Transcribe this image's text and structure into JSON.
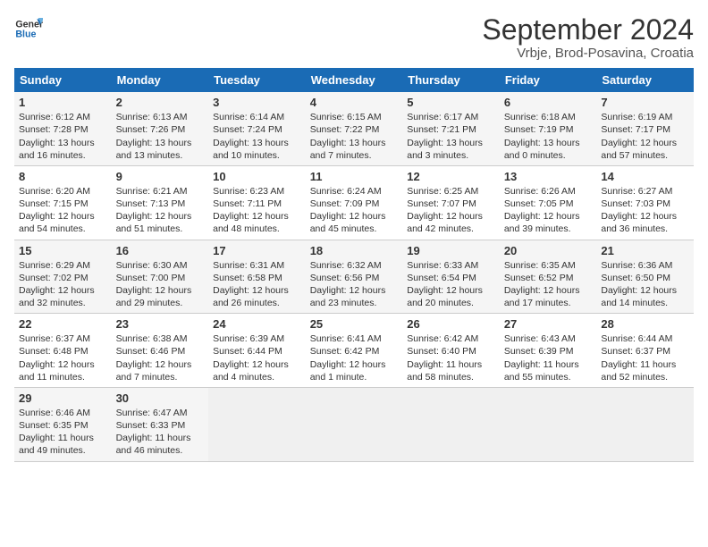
{
  "logo": {
    "text_general": "General",
    "text_blue": "Blue"
  },
  "title": "September 2024",
  "subtitle": "Vrbje, Brod-Posavina, Croatia",
  "headers": [
    "Sunday",
    "Monday",
    "Tuesday",
    "Wednesday",
    "Thursday",
    "Friday",
    "Saturday"
  ],
  "weeks": [
    [
      {
        "day": "1",
        "sunrise": "Sunrise: 6:12 AM",
        "sunset": "Sunset: 7:28 PM",
        "daylight": "Daylight: 13 hours and 16 minutes."
      },
      {
        "day": "2",
        "sunrise": "Sunrise: 6:13 AM",
        "sunset": "Sunset: 7:26 PM",
        "daylight": "Daylight: 13 hours and 13 minutes."
      },
      {
        "day": "3",
        "sunrise": "Sunrise: 6:14 AM",
        "sunset": "Sunset: 7:24 PM",
        "daylight": "Daylight: 13 hours and 10 minutes."
      },
      {
        "day": "4",
        "sunrise": "Sunrise: 6:15 AM",
        "sunset": "Sunset: 7:22 PM",
        "daylight": "Daylight: 13 hours and 7 minutes."
      },
      {
        "day": "5",
        "sunrise": "Sunrise: 6:17 AM",
        "sunset": "Sunset: 7:21 PM",
        "daylight": "Daylight: 13 hours and 3 minutes."
      },
      {
        "day": "6",
        "sunrise": "Sunrise: 6:18 AM",
        "sunset": "Sunset: 7:19 PM",
        "daylight": "Daylight: 13 hours and 0 minutes."
      },
      {
        "day": "7",
        "sunrise": "Sunrise: 6:19 AM",
        "sunset": "Sunset: 7:17 PM",
        "daylight": "Daylight: 12 hours and 57 minutes."
      }
    ],
    [
      {
        "day": "8",
        "sunrise": "Sunrise: 6:20 AM",
        "sunset": "Sunset: 7:15 PM",
        "daylight": "Daylight: 12 hours and 54 minutes."
      },
      {
        "day": "9",
        "sunrise": "Sunrise: 6:21 AM",
        "sunset": "Sunset: 7:13 PM",
        "daylight": "Daylight: 12 hours and 51 minutes."
      },
      {
        "day": "10",
        "sunrise": "Sunrise: 6:23 AM",
        "sunset": "Sunset: 7:11 PM",
        "daylight": "Daylight: 12 hours and 48 minutes."
      },
      {
        "day": "11",
        "sunrise": "Sunrise: 6:24 AM",
        "sunset": "Sunset: 7:09 PM",
        "daylight": "Daylight: 12 hours and 45 minutes."
      },
      {
        "day": "12",
        "sunrise": "Sunrise: 6:25 AM",
        "sunset": "Sunset: 7:07 PM",
        "daylight": "Daylight: 12 hours and 42 minutes."
      },
      {
        "day": "13",
        "sunrise": "Sunrise: 6:26 AM",
        "sunset": "Sunset: 7:05 PM",
        "daylight": "Daylight: 12 hours and 39 minutes."
      },
      {
        "day": "14",
        "sunrise": "Sunrise: 6:27 AM",
        "sunset": "Sunset: 7:03 PM",
        "daylight": "Daylight: 12 hours and 36 minutes."
      }
    ],
    [
      {
        "day": "15",
        "sunrise": "Sunrise: 6:29 AM",
        "sunset": "Sunset: 7:02 PM",
        "daylight": "Daylight: 12 hours and 32 minutes."
      },
      {
        "day": "16",
        "sunrise": "Sunrise: 6:30 AM",
        "sunset": "Sunset: 7:00 PM",
        "daylight": "Daylight: 12 hours and 29 minutes."
      },
      {
        "day": "17",
        "sunrise": "Sunrise: 6:31 AM",
        "sunset": "Sunset: 6:58 PM",
        "daylight": "Daylight: 12 hours and 26 minutes."
      },
      {
        "day": "18",
        "sunrise": "Sunrise: 6:32 AM",
        "sunset": "Sunset: 6:56 PM",
        "daylight": "Daylight: 12 hours and 23 minutes."
      },
      {
        "day": "19",
        "sunrise": "Sunrise: 6:33 AM",
        "sunset": "Sunset: 6:54 PM",
        "daylight": "Daylight: 12 hours and 20 minutes."
      },
      {
        "day": "20",
        "sunrise": "Sunrise: 6:35 AM",
        "sunset": "Sunset: 6:52 PM",
        "daylight": "Daylight: 12 hours and 17 minutes."
      },
      {
        "day": "21",
        "sunrise": "Sunrise: 6:36 AM",
        "sunset": "Sunset: 6:50 PM",
        "daylight": "Daylight: 12 hours and 14 minutes."
      }
    ],
    [
      {
        "day": "22",
        "sunrise": "Sunrise: 6:37 AM",
        "sunset": "Sunset: 6:48 PM",
        "daylight": "Daylight: 12 hours and 11 minutes."
      },
      {
        "day": "23",
        "sunrise": "Sunrise: 6:38 AM",
        "sunset": "Sunset: 6:46 PM",
        "daylight": "Daylight: 12 hours and 7 minutes."
      },
      {
        "day": "24",
        "sunrise": "Sunrise: 6:39 AM",
        "sunset": "Sunset: 6:44 PM",
        "daylight": "Daylight: 12 hours and 4 minutes."
      },
      {
        "day": "25",
        "sunrise": "Sunrise: 6:41 AM",
        "sunset": "Sunset: 6:42 PM",
        "daylight": "Daylight: 12 hours and 1 minute."
      },
      {
        "day": "26",
        "sunrise": "Sunrise: 6:42 AM",
        "sunset": "Sunset: 6:40 PM",
        "daylight": "Daylight: 11 hours and 58 minutes."
      },
      {
        "day": "27",
        "sunrise": "Sunrise: 6:43 AM",
        "sunset": "Sunset: 6:39 PM",
        "daylight": "Daylight: 11 hours and 55 minutes."
      },
      {
        "day": "28",
        "sunrise": "Sunrise: 6:44 AM",
        "sunset": "Sunset: 6:37 PM",
        "daylight": "Daylight: 11 hours and 52 minutes."
      }
    ],
    [
      {
        "day": "29",
        "sunrise": "Sunrise: 6:46 AM",
        "sunset": "Sunset: 6:35 PM",
        "daylight": "Daylight: 11 hours and 49 minutes."
      },
      {
        "day": "30",
        "sunrise": "Sunrise: 6:47 AM",
        "sunset": "Sunset: 6:33 PM",
        "daylight": "Daylight: 11 hours and 46 minutes."
      },
      null,
      null,
      null,
      null,
      null
    ]
  ]
}
